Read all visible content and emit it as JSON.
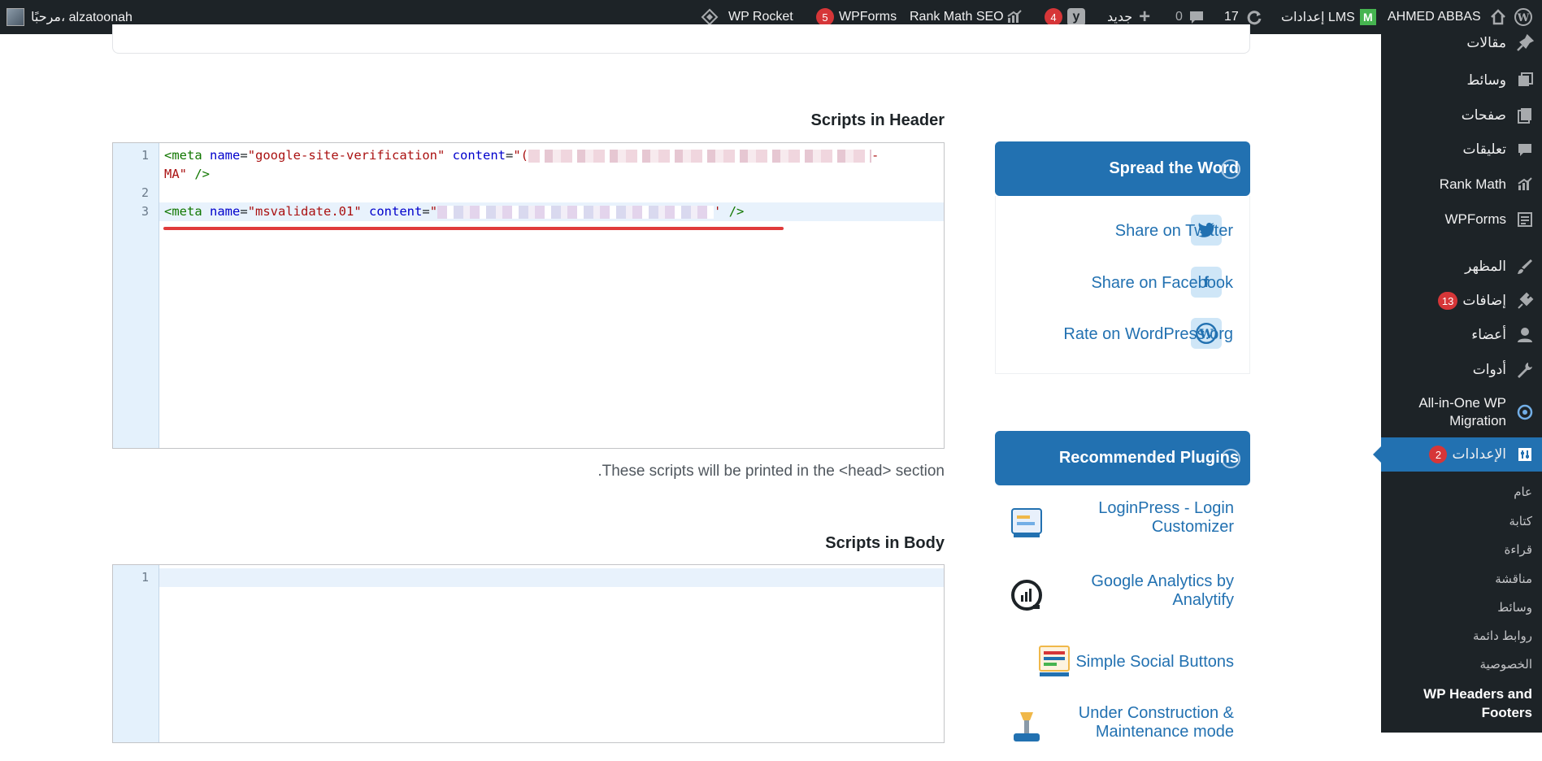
{
  "adminbar": {
    "greeting": "مرحبًا، alzatoonah",
    "user": "AHMED ABBAS",
    "lms_label": "إعدادات LMS",
    "updates_count": "17",
    "comments_count": "0",
    "new_label": "جديد",
    "yoast_badge": "4",
    "rankmath_label": "Rank Math SEO",
    "wpforms_label": "WPForms",
    "wpforms_badge": "5",
    "wprocket_label": "WP Rocket"
  },
  "sidebar": {
    "items": [
      {
        "label": "مقالات",
        "icon": "pin-icon"
      },
      {
        "label": "وسائط",
        "icon": "media-icon"
      },
      {
        "label": "صفحات",
        "icon": "pages-icon"
      },
      {
        "label": "تعليقات",
        "icon": "comments-icon"
      },
      {
        "label": "Rank Math",
        "icon": "rank-math-icon"
      },
      {
        "label": "WPForms",
        "icon": "wpforms-icon"
      },
      {
        "label": "المظهر",
        "icon": "appearance-icon"
      },
      {
        "label": "إضافات",
        "icon": "plugins-icon",
        "badge": "13"
      },
      {
        "label": "أعضاء",
        "icon": "users-icon"
      },
      {
        "label": "أدوات",
        "icon": "tools-icon"
      },
      {
        "label": "All-in-One WP Migration",
        "icon": "migration-icon"
      },
      {
        "label": "الإعدادات",
        "icon": "settings-icon",
        "badge": "2"
      }
    ],
    "submenu": [
      "عام",
      "كتابة",
      "قراءة",
      "مناقشة",
      "وسائط",
      "روابط دائمة",
      "الخصوصية",
      "WP Headers and Footers"
    ]
  },
  "header_scripts": {
    "title": "Scripts in Header",
    "line_numbers": [
      "1",
      "2",
      "3"
    ],
    "line1_tag_open": "<meta",
    "line1_attr1": "name",
    "line1_val1": "\"google-site-verification\"",
    "line1_attr2": "content",
    "line1_val2_start": "\"(",
    "line1_cont": "MA\"",
    "line1_tag_close": "/>",
    "line3_tag_open": "<meta",
    "line3_attr1": "name",
    "line3_val1": "\"msvalidate.01\"",
    "line3_attr2": "content",
    "line3_val2_start": "\"",
    "line3_val2_end": "'",
    "line3_tag_close": "/>",
    "help": ".These scripts will be printed in the <head> section"
  },
  "body_scripts": {
    "title": "Scripts in Body",
    "line_numbers": [
      "1"
    ]
  },
  "spread_widget": {
    "title": "Spread the Word",
    "links": [
      {
        "label": "Share on Twitter",
        "icon": "twitter-icon"
      },
      {
        "label": "Share on Facebook",
        "icon": "facebook-icon"
      },
      {
        "label": "Rate on WordPress.org",
        "icon": "wordpress-icon"
      }
    ]
  },
  "recommended_widget": {
    "title": "Recommended Plugins",
    "plugins": [
      {
        "name": "LoginPress - Login Customizer",
        "icon": "loginpress-icon"
      },
      {
        "name": "Google Analytics by Analytify",
        "icon": "analytify-icon"
      },
      {
        "name": "Simple Social Buttons",
        "icon": "social-buttons-icon"
      },
      {
        "name": "Under Construction & Maintenance mode",
        "icon": "under-construction-icon"
      }
    ]
  },
  "colors": {
    "admin_bar": "#1d2327",
    "accent": "#2271b1",
    "badge": "#d63638",
    "underline": "#e03b3b"
  }
}
